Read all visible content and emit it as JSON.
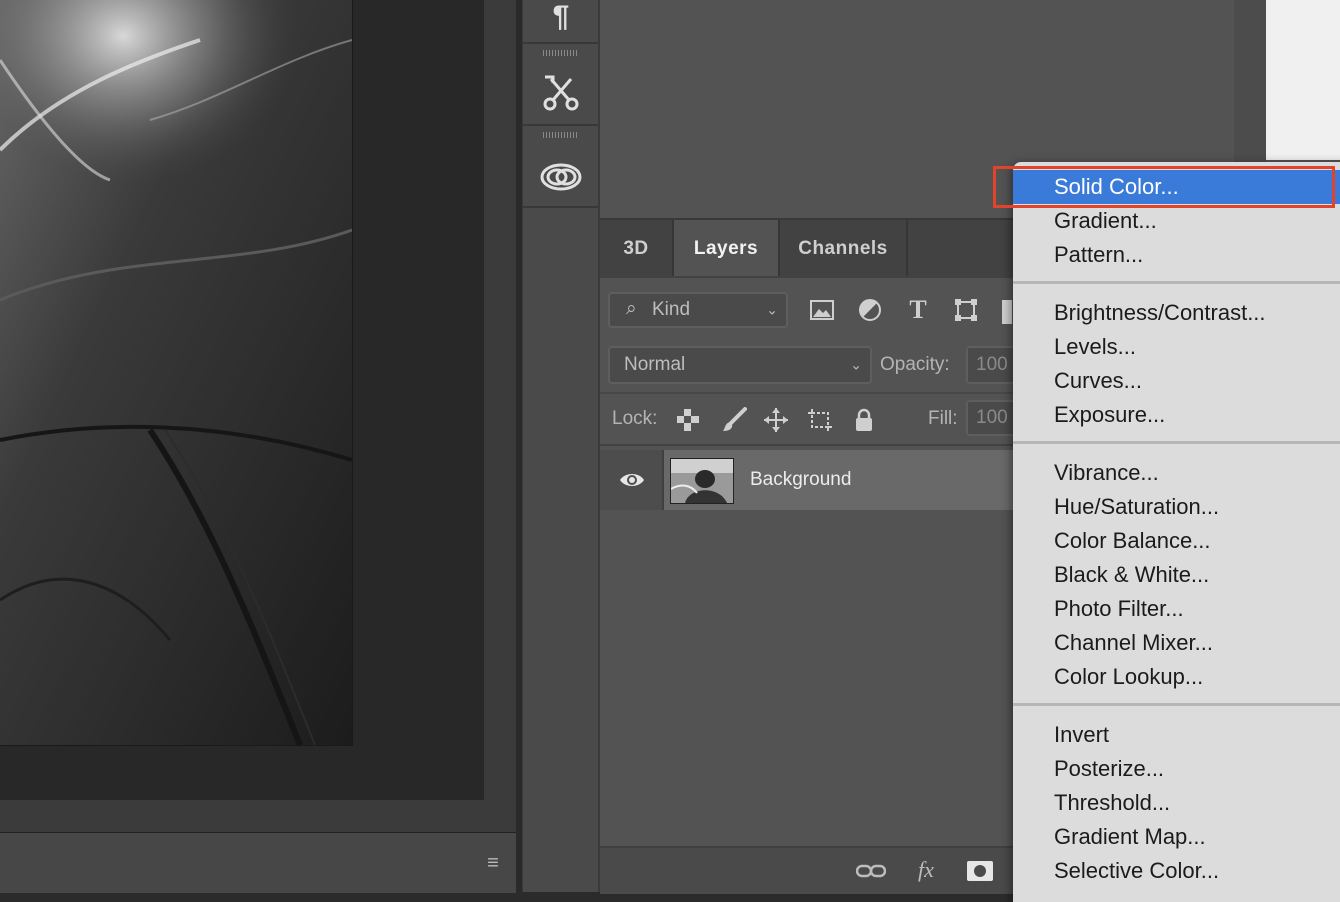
{
  "tabs": [
    {
      "label": "3D",
      "active": false
    },
    {
      "label": "Layers",
      "active": true
    },
    {
      "label": "Channels",
      "active": false
    }
  ],
  "filter": {
    "kind_label": "Kind"
  },
  "blend": {
    "mode": "Normal",
    "opacity_label": "Opacity:",
    "opacity_value": "100"
  },
  "lock": {
    "label": "Lock:",
    "fill_label": "Fill:",
    "fill_value": "100"
  },
  "layers": [
    {
      "name": "Background",
      "visible": true
    }
  ],
  "footer": {
    "fx_label": "fx"
  },
  "menu": {
    "groups": [
      [
        {
          "label": "Solid Color...",
          "highlighted": true
        },
        {
          "label": "Gradient..."
        },
        {
          "label": "Pattern..."
        }
      ],
      [
        {
          "label": "Brightness/Contrast..."
        },
        {
          "label": "Levels..."
        },
        {
          "label": "Curves..."
        },
        {
          "label": "Exposure..."
        }
      ],
      [
        {
          "label": "Vibrance..."
        },
        {
          "label": "Hue/Saturation..."
        },
        {
          "label": "Color Balance..."
        },
        {
          "label": "Black & White..."
        },
        {
          "label": "Photo Filter..."
        },
        {
          "label": "Channel Mixer..."
        },
        {
          "label": "Color Lookup..."
        }
      ],
      [
        {
          "label": "Invert"
        },
        {
          "label": "Posterize..."
        },
        {
          "label": "Threshold..."
        },
        {
          "label": "Gradient Map..."
        },
        {
          "label": "Selective Color..."
        }
      ]
    ]
  },
  "colors": {
    "highlight": "#3a7ad8",
    "focus_outline": "#e0442a",
    "panel": "#535353"
  }
}
